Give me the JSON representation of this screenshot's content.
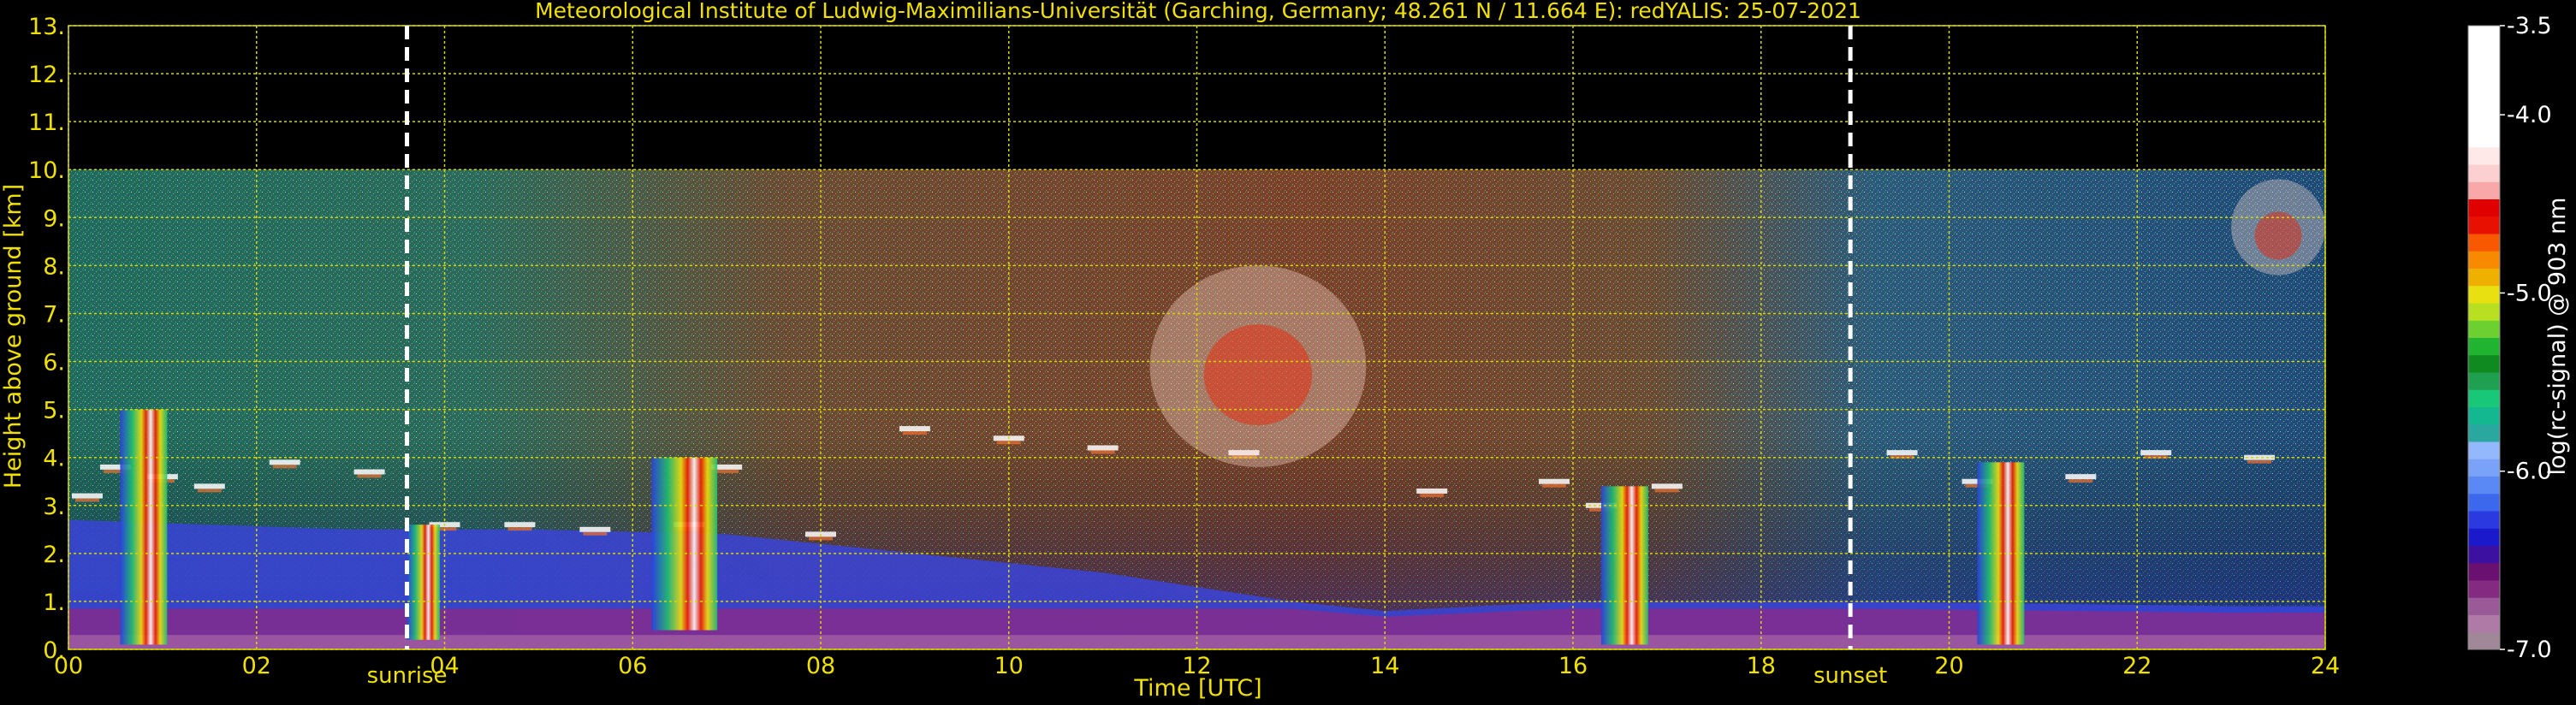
{
  "chart_data": {
    "type": "heatmap",
    "title": "Meteorological Institute of Ludwig-Maximilians-Universität (Garching, Germany; 48.261 N / 11.664 E):    redYALIS: 25-07-2021",
    "xlabel": "Time [UTC]",
    "ylabel": "Height above ground [km]",
    "xlim": [
      0,
      24
    ],
    "ylim": [
      0,
      13
    ],
    "x_ticks": [
      "00",
      "02",
      "04",
      "06",
      "08",
      "10",
      "12",
      "14",
      "16",
      "18",
      "20",
      "22",
      "24"
    ],
    "y_ticks": [
      "0.",
      "1.",
      "2.",
      "3.",
      "4.",
      "5.",
      "6.",
      "7.",
      "8.",
      "9.",
      "10.",
      "11.",
      "12.",
      "13."
    ],
    "grid": true,
    "data_top_km": 10,
    "markers": [
      {
        "label": "sunrise",
        "time": 3.6
      },
      {
        "label": "sunset",
        "time": 18.95
      }
    ],
    "colorbar": {
      "label": "log(rc-signal) @ 903 nm",
      "ticks": [
        "-3.5",
        "-4.0",
        "-5.0",
        "-6.0",
        "-7.0"
      ],
      "range": [
        -7.0,
        -3.5
      ],
      "palette": [
        "#a08898",
        "#b07aa6",
        "#9a5a98",
        "#842a80",
        "#6a1070",
        "#3c10a0",
        "#1a1acc",
        "#2a3ae0",
        "#3c68ee",
        "#5a88f4",
        "#7aa2f8",
        "#94b8fc",
        "#2aa8a0",
        "#14b890",
        "#18c878",
        "#1ea050",
        "#0e8a20",
        "#20b430",
        "#6cd030",
        "#b8e020",
        "#e8e010",
        "#f0b000",
        "#f88a00",
        "#f85800",
        "#e81000",
        "#e00000",
        "#f8a8a8",
        "#fcd0d0",
        "#ffe8e8",
        "#ffffff",
        "#ffffff",
        "#ffffff",
        "#ffffff",
        "#ffffff",
        "#ffffff",
        "#ffffff"
      ]
    },
    "boundary_layer_top_km": [
      [
        0.0,
        2.7
      ],
      [
        1.5,
        2.6
      ],
      [
        3.0,
        2.5
      ],
      [
        5.0,
        2.5
      ],
      [
        7.0,
        2.4
      ],
      [
        9.0,
        2.0
      ],
      [
        11.0,
        1.6
      ],
      [
        13.0,
        1.0
      ],
      [
        14.0,
        0.8
      ],
      [
        15.0,
        0.9
      ],
      [
        16.0,
        1.0
      ],
      [
        17.0,
        1.0
      ],
      [
        19.0,
        1.0
      ],
      [
        21.0,
        0.95
      ],
      [
        23.0,
        0.9
      ],
      [
        24.0,
        0.9
      ]
    ],
    "cloud_layer_points_km": [
      [
        0.2,
        3.2
      ],
      [
        0.5,
        3.8
      ],
      [
        1.0,
        3.6
      ],
      [
        1.5,
        3.4
      ],
      [
        2.3,
        3.9
      ],
      [
        3.2,
        3.7
      ],
      [
        4.0,
        2.6
      ],
      [
        4.8,
        2.6
      ],
      [
        5.6,
        2.5
      ],
      [
        6.6,
        2.6
      ],
      [
        7.0,
        3.8
      ],
      [
        8.0,
        2.4
      ],
      [
        9.0,
        4.6
      ],
      [
        10.0,
        4.4
      ],
      [
        11.0,
        4.2
      ],
      [
        12.5,
        4.1
      ],
      [
        14.5,
        3.3
      ],
      [
        15.8,
        3.5
      ],
      [
        16.3,
        3.0
      ],
      [
        17.0,
        3.4
      ],
      [
        19.5,
        4.1
      ],
      [
        20.3,
        3.5
      ],
      [
        21.4,
        3.6
      ],
      [
        22.2,
        4.1
      ],
      [
        23.3,
        4.0
      ]
    ],
    "aerosol_plumes_km": [
      {
        "t0": 0.55,
        "t1": 1.05,
        "hbot": 0.1,
        "htop": 5.0
      },
      {
        "t0": 3.6,
        "t1": 3.95,
        "hbot": 0.2,
        "htop": 2.6
      },
      {
        "t0": 6.2,
        "t1": 6.9,
        "hbot": 0.4,
        "htop": 4.0
      },
      {
        "t0": 16.3,
        "t1": 16.8,
        "hbot": 0.1,
        "htop": 3.4
      },
      {
        "t0": 20.3,
        "t1": 20.8,
        "hbot": 0.1,
        "htop": 3.9
      }
    ],
    "cirrus_km": [
      {
        "t0": 11.5,
        "t1": 13.8,
        "hbot": 3.8,
        "htop": 8.0
      },
      {
        "t0": 23.0,
        "t1": 24.0,
        "hbot": 7.8,
        "htop": 9.8
      }
    ]
  }
}
